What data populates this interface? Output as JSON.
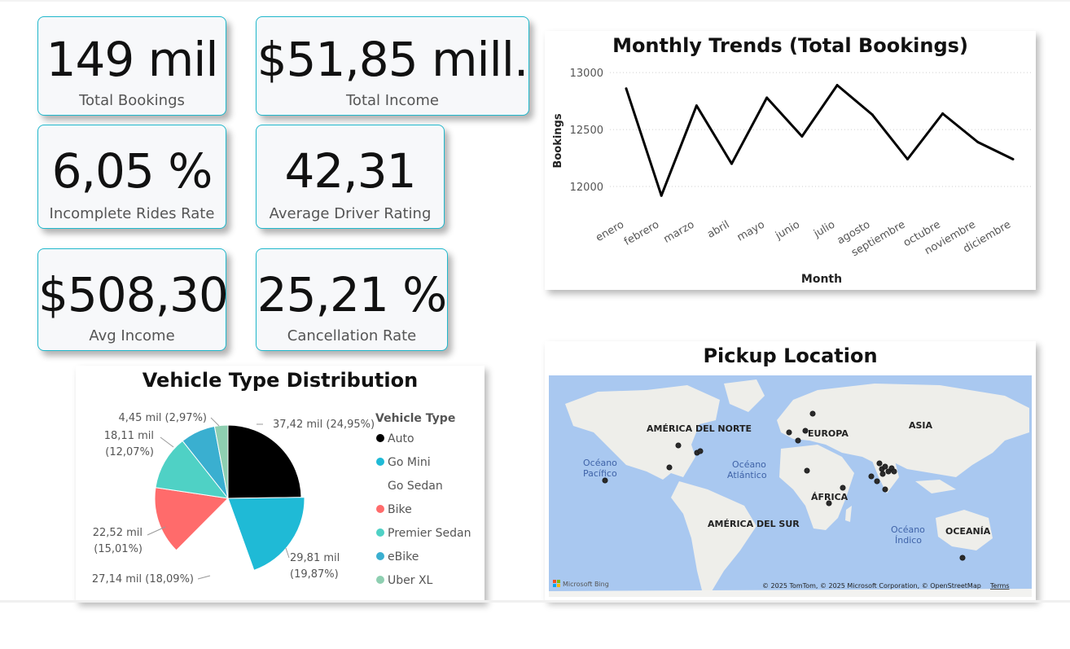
{
  "kpis": {
    "total_bookings": {
      "value": "149 mil",
      "label": "Total Bookings"
    },
    "total_income": {
      "value": "$51,85 mill.",
      "label": "Total Income"
    },
    "incomplete_rate": {
      "value": "6,05 %",
      "label": "Incomplete Rides Rate"
    },
    "avg_rating": {
      "value": "42,31",
      "label": "Average Driver Rating"
    },
    "avg_income": {
      "value": "$508,30",
      "label": "Avg Income"
    },
    "cancel_rate": {
      "value": "25,21 %",
      "label": "Cancellation Rate"
    }
  },
  "line_chart": {
    "title": "Monthly Trends (Total Bookings)"
  },
  "pie_chart": {
    "title": "Vehicle Type Distribution",
    "legend_title": "Vehicle Type",
    "slice_labels": [
      {
        "line1": "37,42 mil (24,95%)",
        "line2": ""
      },
      {
        "line1": "29,81 mil",
        "line2": "(19,87%)"
      },
      {
        "line1": "27,14 mil (18,09%)",
        "line2": ""
      },
      {
        "line1": "22,52 mil",
        "line2": "(15,01%)"
      },
      {
        "line1": "18,11 mil",
        "line2": "(12,07%)"
      },
      {
        "line1": "4,45 mil (2,97%)",
        "line2": ""
      }
    ]
  },
  "map": {
    "title": "Pickup Location",
    "labels": {
      "north_america": "AMÉRICA DEL NORTE",
      "south_america": "AMÉRICA DEL SUR",
      "europe": "EUROPA",
      "asia": "ASIA",
      "africa": "ÁFRICA",
      "oceania": "OCEANÍA",
      "pacific": "Océano Pacífico",
      "pacific_line1": "Océano",
      "pacific_line2": "Pacífico",
      "atlantic_line1": "Océano",
      "atlantic_line2": "Atlántico",
      "indian_line1": "Océano",
      "indian_line2": "Índico"
    },
    "brand": "Microsoft Bing",
    "copyright": "© 2025 TomTom, © 2025 Microsoft Corporation, © OpenStreetMap",
    "terms": "Terms",
    "colors": {
      "water": "#a9c8f0",
      "land": "#eeeeea",
      "marker": "#2b2b2b"
    }
  },
  "chart_data": [
    {
      "type": "line",
      "title": "Monthly Trends (Total Bookings)",
      "xlabel": "Month",
      "ylabel": "Bookings",
      "categories": [
        "enero",
        "febrero",
        "marzo",
        "abril",
        "mayo",
        "junio",
        "julio",
        "agosto",
        "septiembre",
        "octubre",
        "noviembre",
        "diciembre"
      ],
      "values": [
        12860,
        11920,
        12710,
        12200,
        12780,
        12440,
        12890,
        12630,
        12240,
        12640,
        12390,
        12240
      ],
      "yticks": [
        12000,
        12500,
        13000
      ],
      "ylim": [
        11850,
        13080
      ],
      "grid": true,
      "line_color": "#000000"
    },
    {
      "type": "pie",
      "title": "Vehicle Type Distribution",
      "legend_title": "Vehicle Type",
      "legend_position": "right",
      "categories": [
        "Auto",
        "Go Mini",
        "Go Sedan",
        "Bike",
        "Premier Sedan",
        "eBike",
        "Uber XL"
      ],
      "values": [
        37.42,
        29.81,
        27.14,
        22.52,
        18.11,
        11.64,
        4.45
      ],
      "percent": [
        24.95,
        19.87,
        18.09,
        15.01,
        12.07,
        7.76,
        2.97
      ],
      "colors": [
        "#000000",
        "#1fbad6",
        "#ffffff",
        "#ff6b6b",
        "#4fd1c5",
        "#3aafd0",
        "#8ecfb1"
      ]
    }
  ]
}
